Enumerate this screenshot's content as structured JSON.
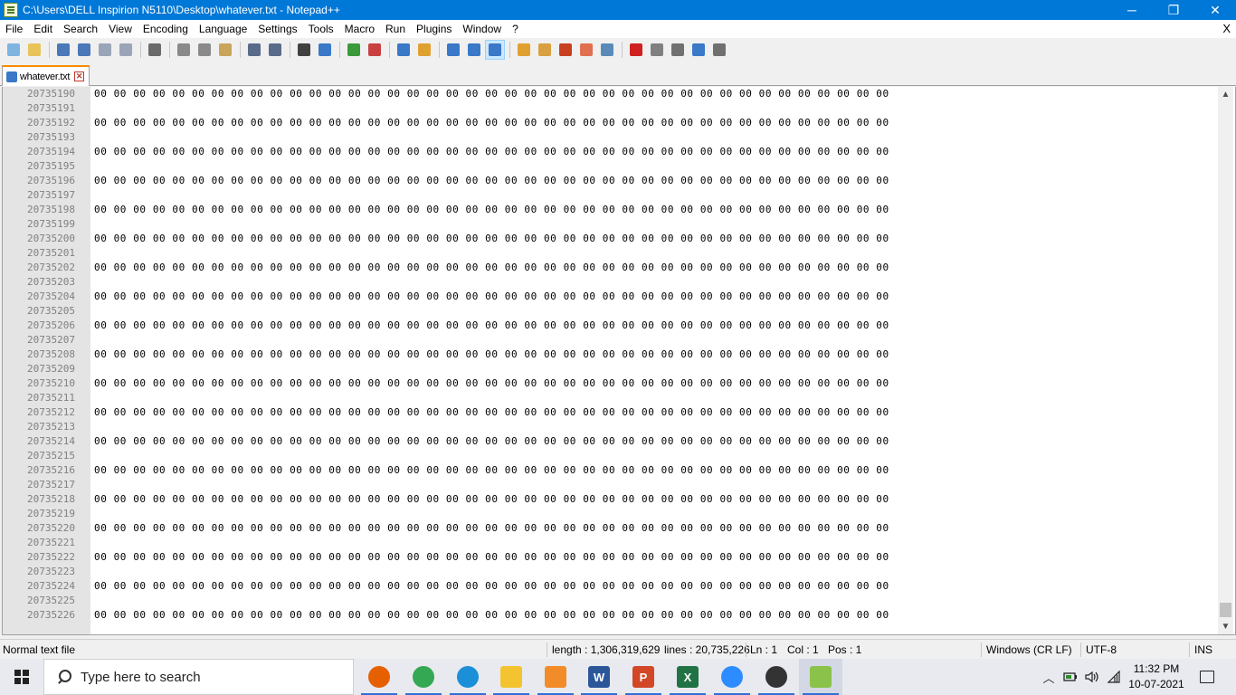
{
  "window": {
    "title": "C:\\Users\\DELL Inspirion N5110\\Desktop\\whatever.txt - Notepad++",
    "minimize": "─",
    "restore": "❐",
    "close": "✕"
  },
  "menu": {
    "items": [
      "File",
      "Edit",
      "Search",
      "View",
      "Encoding",
      "Language",
      "Settings",
      "Tools",
      "Macro",
      "Run",
      "Plugins",
      "Window",
      "?"
    ],
    "close_doc": "X"
  },
  "toolbar": {
    "icons": [
      "new-file-icon",
      "open-file-icon",
      "save-icon",
      "save-all-icon",
      "close-icon",
      "close-all-icon",
      "print-icon",
      "cut-icon",
      "copy-icon",
      "paste-icon",
      "undo-icon",
      "redo-icon",
      "find-icon",
      "replace-icon",
      "zoom-in-icon",
      "zoom-out-icon",
      "sync-vertical-icon",
      "sync-horizontal-icon",
      "word-wrap-icon",
      "show-all-chars-icon",
      "indent-guide-icon",
      "user-language-icon",
      "document-map-icon",
      "function-list-icon",
      "folder-workspace-icon",
      "monitoring-icon",
      "record-macro-icon",
      "stop-recording-icon",
      "playback-macro-icon",
      "run-macro-multiple-icon",
      "save-macro-icon"
    ]
  },
  "tab": {
    "label": "whatever.txt",
    "close": "✕"
  },
  "editor": {
    "lines": [
      {
        "num": "20735190",
        "text": "00 00 00 00 00 00 00 00 00 00 00 00 00 00 00 00 00 00 00 00 00 00 00 00 00 00 00 00 00 00 00 00 00 00 00 00 00 00 00 00 00"
      },
      {
        "num": "20735191",
        "text": ""
      },
      {
        "num": "20735192",
        "text": "00 00 00 00 00 00 00 00 00 00 00 00 00 00 00 00 00 00 00 00 00 00 00 00 00 00 00 00 00 00 00 00 00 00 00 00 00 00 00 00 00"
      },
      {
        "num": "20735193",
        "text": ""
      },
      {
        "num": "20735194",
        "text": "00 00 00 00 00 00 00 00 00 00 00 00 00 00 00 00 00 00 00 00 00 00 00 00 00 00 00 00 00 00 00 00 00 00 00 00 00 00 00 00 00"
      },
      {
        "num": "20735195",
        "text": ""
      },
      {
        "num": "20735196",
        "text": "00 00 00 00 00 00 00 00 00 00 00 00 00 00 00 00 00 00 00 00 00 00 00 00 00 00 00 00 00 00 00 00 00 00 00 00 00 00 00 00 00"
      },
      {
        "num": "20735197",
        "text": ""
      },
      {
        "num": "20735198",
        "text": "00 00 00 00 00 00 00 00 00 00 00 00 00 00 00 00 00 00 00 00 00 00 00 00 00 00 00 00 00 00 00 00 00 00 00 00 00 00 00 00 00"
      },
      {
        "num": "20735199",
        "text": ""
      },
      {
        "num": "20735200",
        "text": "00 00 00 00 00 00 00 00 00 00 00 00 00 00 00 00 00 00 00 00 00 00 00 00 00 00 00 00 00 00 00 00 00 00 00 00 00 00 00 00 00"
      },
      {
        "num": "20735201",
        "text": ""
      },
      {
        "num": "20735202",
        "text": "00 00 00 00 00 00 00 00 00 00 00 00 00 00 00 00 00 00 00 00 00 00 00 00 00 00 00 00 00 00 00 00 00 00 00 00 00 00 00 00 00"
      },
      {
        "num": "20735203",
        "text": ""
      },
      {
        "num": "20735204",
        "text": "00 00 00 00 00 00 00 00 00 00 00 00 00 00 00 00 00 00 00 00 00 00 00 00 00 00 00 00 00 00 00 00 00 00 00 00 00 00 00 00 00"
      },
      {
        "num": "20735205",
        "text": ""
      },
      {
        "num": "20735206",
        "text": "00 00 00 00 00 00 00 00 00 00 00 00 00 00 00 00 00 00 00 00 00 00 00 00 00 00 00 00 00 00 00 00 00 00 00 00 00 00 00 00 00"
      },
      {
        "num": "20735207",
        "text": ""
      },
      {
        "num": "20735208",
        "text": "00 00 00 00 00 00 00 00 00 00 00 00 00 00 00 00 00 00 00 00 00 00 00 00 00 00 00 00 00 00 00 00 00 00 00 00 00 00 00 00 00"
      },
      {
        "num": "20735209",
        "text": ""
      },
      {
        "num": "20735210",
        "text": "00 00 00 00 00 00 00 00 00 00 00 00 00 00 00 00 00 00 00 00 00 00 00 00 00 00 00 00 00 00 00 00 00 00 00 00 00 00 00 00 00"
      },
      {
        "num": "20735211",
        "text": ""
      },
      {
        "num": "20735212",
        "text": "00 00 00 00 00 00 00 00 00 00 00 00 00 00 00 00 00 00 00 00 00 00 00 00 00 00 00 00 00 00 00 00 00 00 00 00 00 00 00 00 00"
      },
      {
        "num": "20735213",
        "text": ""
      },
      {
        "num": "20735214",
        "text": "00 00 00 00 00 00 00 00 00 00 00 00 00 00 00 00 00 00 00 00 00 00 00 00 00 00 00 00 00 00 00 00 00 00 00 00 00 00 00 00 00"
      },
      {
        "num": "20735215",
        "text": ""
      },
      {
        "num": "20735216",
        "text": "00 00 00 00 00 00 00 00 00 00 00 00 00 00 00 00 00 00 00 00 00 00 00 00 00 00 00 00 00 00 00 00 00 00 00 00 00 00 00 00 00"
      },
      {
        "num": "20735217",
        "text": ""
      },
      {
        "num": "20735218",
        "text": "00 00 00 00 00 00 00 00 00 00 00 00 00 00 00 00 00 00 00 00 00 00 00 00 00 00 00 00 00 00 00 00 00 00 00 00 00 00 00 00 00"
      },
      {
        "num": "20735219",
        "text": ""
      },
      {
        "num": "20735220",
        "text": "00 00 00 00 00 00 00 00 00 00 00 00 00 00 00 00 00 00 00 00 00 00 00 00 00 00 00 00 00 00 00 00 00 00 00 00 00 00 00 00 00"
      },
      {
        "num": "20735221",
        "text": ""
      },
      {
        "num": "20735222",
        "text": "00 00 00 00 00 00 00 00 00 00 00 00 00 00 00 00 00 00 00 00 00 00 00 00 00 00 00 00 00 00 00 00 00 00 00 00 00 00 00 00 00"
      },
      {
        "num": "20735223",
        "text": ""
      },
      {
        "num": "20735224",
        "text": "00 00 00 00 00 00 00 00 00 00 00 00 00 00 00 00 00 00 00 00 00 00 00 00 00 00 00 00 00 00 00 00 00 00 00 00 00 00 00 00 00"
      },
      {
        "num": "20735225",
        "text": ""
      },
      {
        "num": "20735226",
        "text": "00 00 00 00 00 00 00 00 00 00 00 00 00 00 00 00 00 00 00 00 00 00 00 00 00 00 00 00 00 00 00 00 00 00 00 00 00 00 00 00 00"
      }
    ],
    "scroll_up": "▲",
    "scroll_down": "▼"
  },
  "status": {
    "file_type": "Normal text file",
    "length": "length : 1,306,319,629",
    "lines": "lines : 20,735,226",
    "ln": "Ln : 1",
    "col": "Col : 1",
    "pos": "Pos : 1",
    "eol": "Windows (CR LF)",
    "encoding": "UTF-8",
    "mode": "INS"
  },
  "taskbar": {
    "search_placeholder": "Type here to search",
    "apps": [
      {
        "name": "firefox-icon",
        "color": "#e66000",
        "glyph": ""
      },
      {
        "name": "chrome-icon",
        "color": "#34a853",
        "glyph": ""
      },
      {
        "name": "edge-icon",
        "color": "#1b8fd8",
        "glyph": ""
      },
      {
        "name": "file-explorer-icon",
        "color": "#f4c430",
        "glyph": ""
      },
      {
        "name": "scratch-icon",
        "color": "#f28c28",
        "glyph": ""
      },
      {
        "name": "word-icon",
        "color": "#2b579a",
        "glyph": "W"
      },
      {
        "name": "powerpoint-icon",
        "color": "#d24726",
        "glyph": "P"
      },
      {
        "name": "excel-icon",
        "color": "#217346",
        "glyph": "X"
      },
      {
        "name": "zoom-icon",
        "color": "#2d8cff",
        "glyph": ""
      },
      {
        "name": "media-player-icon",
        "color": "#333333",
        "glyph": ""
      },
      {
        "name": "notepadpp-icon",
        "color": "#8bc34a",
        "glyph": ""
      }
    ],
    "tray_chevron": "︿",
    "time": "11:32 PM",
    "date": "10-07-2021"
  }
}
